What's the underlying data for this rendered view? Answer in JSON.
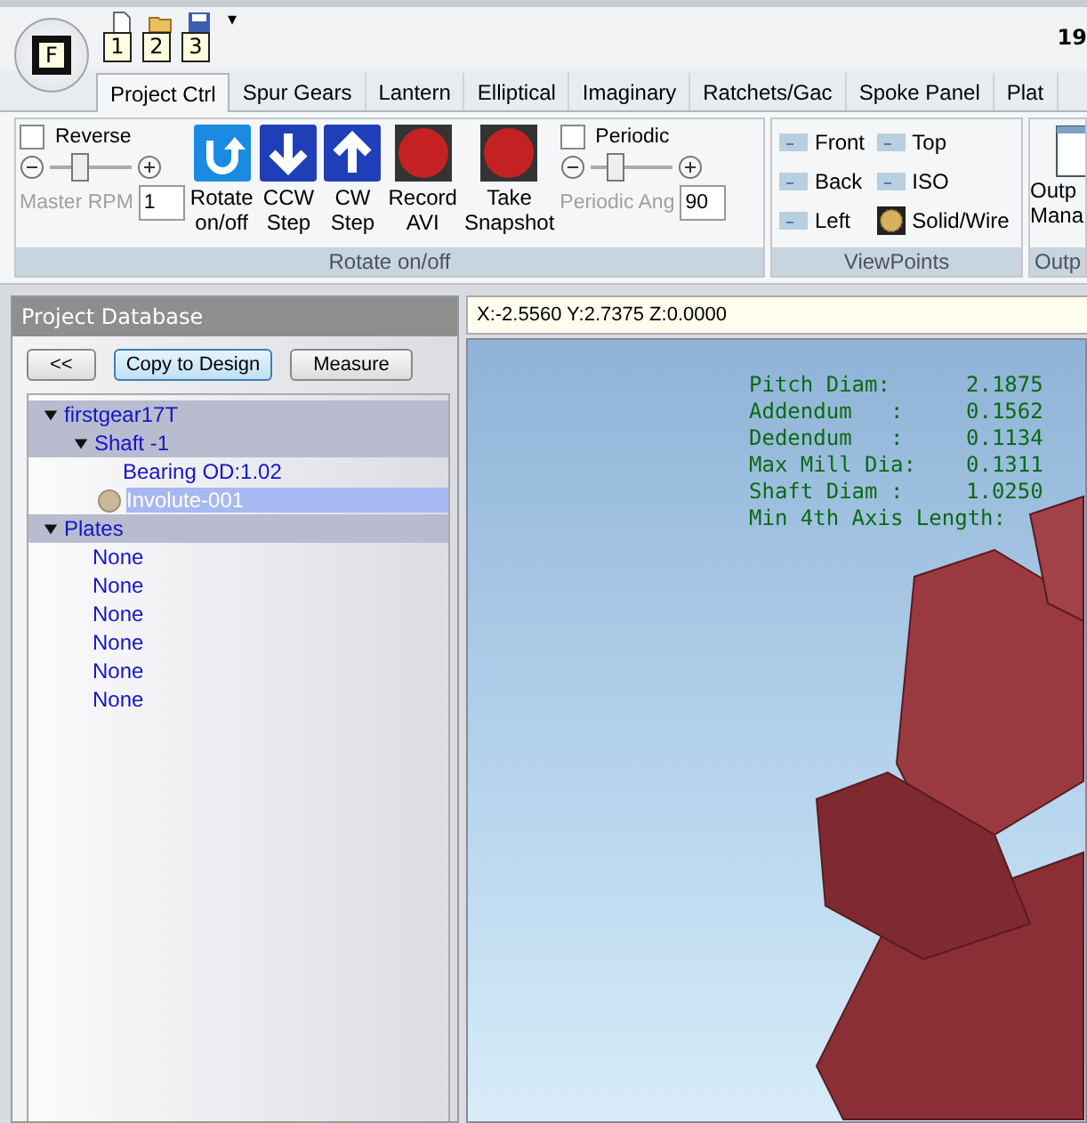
{
  "app_button": {
    "label": "F"
  },
  "quick_access": [
    {
      "kind": "new",
      "keytip": "1"
    },
    {
      "kind": "open",
      "keytip": "2"
    },
    {
      "kind": "save",
      "keytip": "3"
    }
  ],
  "quick_access_menu": "▾",
  "title": "19",
  "tabs": [
    {
      "label": "Project Ctrl",
      "selected": true
    },
    {
      "label": "Spur Gears",
      "selected": false
    },
    {
      "label": "Lantern",
      "selected": false
    },
    {
      "label": "Elliptical",
      "selected": false
    },
    {
      "label": "Imaginary",
      "selected": false
    },
    {
      "label": "Ratchets/Gac",
      "selected": false
    },
    {
      "label": "Spoke Panel",
      "selected": false
    },
    {
      "label": "Plat",
      "selected": false
    }
  ],
  "rotate_group": {
    "label": "Rotate on/off",
    "reverse": {
      "label": "Reverse",
      "checked": false
    },
    "rpm_slider": {
      "level": 0.35,
      "label": "Master RPM",
      "value": "1",
      "disabled": true
    },
    "buttons": [
      {
        "kind": "rotate",
        "label": "Rotate on/off"
      },
      {
        "kind": "down",
        "label": "CCW Step"
      },
      {
        "kind": "up",
        "label": "CW Step"
      },
      {
        "kind": "record",
        "label": "Record AVI"
      },
      {
        "kind": "record",
        "label": "Take Snapshot"
      }
    ],
    "periodic": {
      "label": "Periodic",
      "checked": false
    },
    "angle_slider": {
      "level": 0.3,
      "label": "Periodic Ang",
      "value": "90",
      "disabled": true
    }
  },
  "viewpoints_group": {
    "label": "ViewPoints",
    "buttons": [
      {
        "kind": "view",
        "label": "Front"
      },
      {
        "kind": "view",
        "label": "Top"
      },
      {
        "kind": "view",
        "label": "Back"
      },
      {
        "kind": "view",
        "label": "ISO"
      },
      {
        "kind": "view",
        "label": "Left"
      },
      {
        "kind": "solid",
        "label": "Solid/Wire"
      }
    ]
  },
  "output_group": {
    "label": "Outp",
    "button": {
      "line1": "Outp",
      "line2": "Mana"
    }
  },
  "project_panel": {
    "title": "Project Database",
    "buttons": [
      {
        "label": "<<",
        "focused": false
      },
      {
        "label": "Copy to Design",
        "focused": true
      },
      {
        "label": "Measure",
        "focused": false
      }
    ],
    "tree": [
      {
        "label": "firstgear17T",
        "kind": "group",
        "expanded": true,
        "selected": false,
        "children": [
          {
            "label": "Shaft -1",
            "kind": "group",
            "expanded": true,
            "selected": false,
            "children": [
              {
                "label": "Bearing OD:1.02",
                "kind": "property",
                "selected": false
              },
              {
                "label": "Involute-001",
                "kind": "part",
                "selected": true
              }
            ]
          }
        ]
      },
      {
        "label": "Plates",
        "kind": "group",
        "expanded": true,
        "selected": false,
        "children": [
          {
            "label": "None",
            "kind": "property",
            "selected": false
          },
          {
            "label": "None",
            "kind": "property",
            "selected": false
          },
          {
            "label": "None",
            "kind": "property",
            "selected": false
          },
          {
            "label": "None",
            "kind": "property",
            "selected": false
          },
          {
            "label": "None",
            "kind": "property",
            "selected": false
          },
          {
            "label": "None",
            "kind": "property",
            "selected": false
          }
        ]
      }
    ]
  },
  "coordinates": "X:-2.5560 Y:2.7375 Z:0.0000",
  "gear_info": [
    {
      "label": "Pitch Diam:",
      "value": "2.1875"
    },
    {
      "label": "Addendum   :",
      "value": "0.1562"
    },
    {
      "label": "Dedendum   :",
      "value": "0.1134"
    },
    {
      "label": "Max Mill Dia:",
      "value": "0.1311"
    },
    {
      "label": "Shaft Diam :",
      "value": "1.0250"
    },
    {
      "label": "Min 4th Axis Length:"
    }
  ]
}
